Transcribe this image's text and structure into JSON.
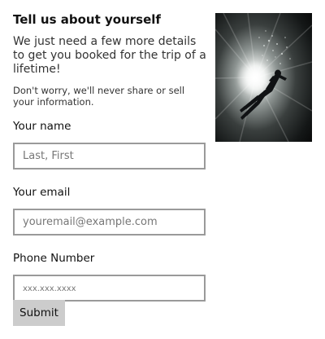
{
  "page": {
    "title": "Tell us about yourself",
    "intro": "We just need a few more details to get you booked for the trip of a lifetime!",
    "privacy_note": "Don't worry, we'll never share or sell your information."
  },
  "form": {
    "name": {
      "label": "Your name",
      "placeholder": "Last, First",
      "value": ""
    },
    "email": {
      "label": "Your email",
      "placeholder": "youremail@example.com",
      "value": ""
    },
    "phone": {
      "label": "Phone Number",
      "placeholder": "xxx.xxx.xxxx",
      "value": ""
    },
    "submit_label": "Submit"
  },
  "image": {
    "subject": "scuba diver silhouetted against sunlight underwater",
    "icon": "diver-photo"
  },
  "colors": {
    "input_border": "#9a9a9a",
    "button_bg": "#cccccc",
    "text": "#222222"
  }
}
